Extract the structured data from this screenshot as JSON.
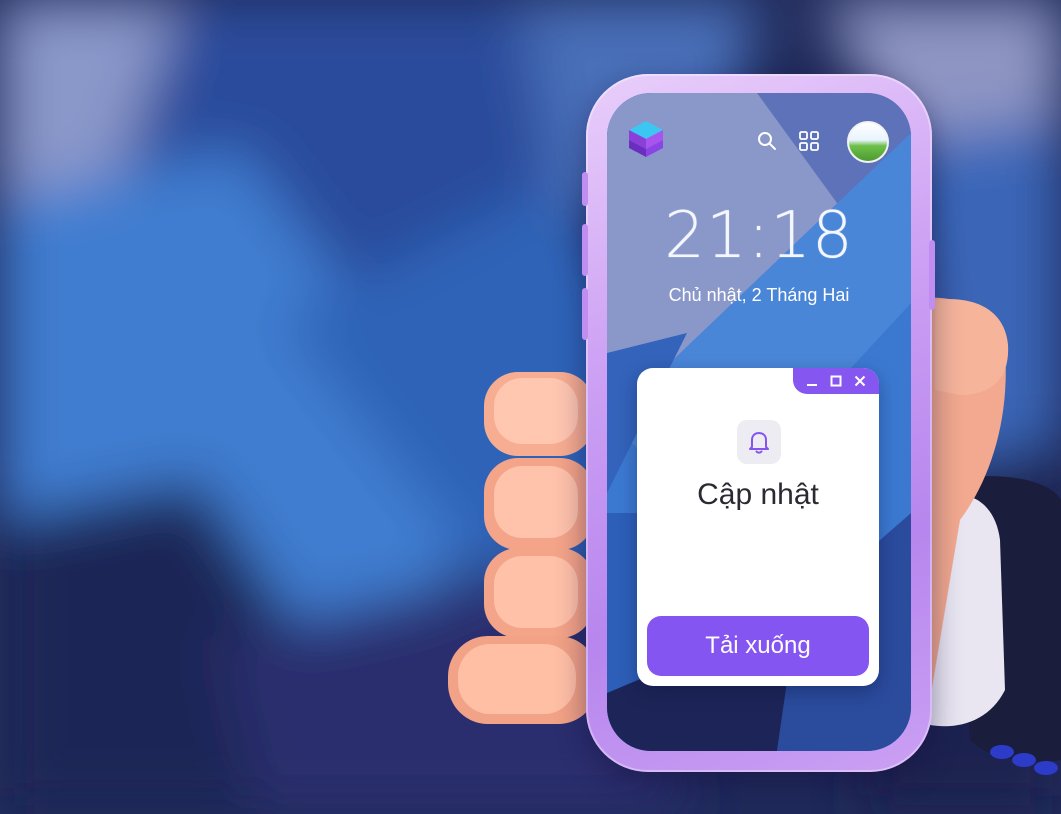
{
  "lock_screen": {
    "time": "21:18",
    "date": "Chủ nhật, 2 Tháng Hai"
  },
  "status_bar": {
    "icons": [
      "app-logo-icon",
      "search-icon",
      "grid-icon",
      "avatar"
    ]
  },
  "notification": {
    "title": "Cập nhật",
    "button_label": "Tải xuống",
    "icon": "bell-icon",
    "window_controls": [
      "minimize-icon",
      "maximize-icon",
      "close-icon"
    ]
  },
  "colors": {
    "accent": "#8555f2",
    "phone_frame": "#c596f2",
    "card_bg": "#ffffff",
    "screen_bg": "#3b79d1"
  }
}
